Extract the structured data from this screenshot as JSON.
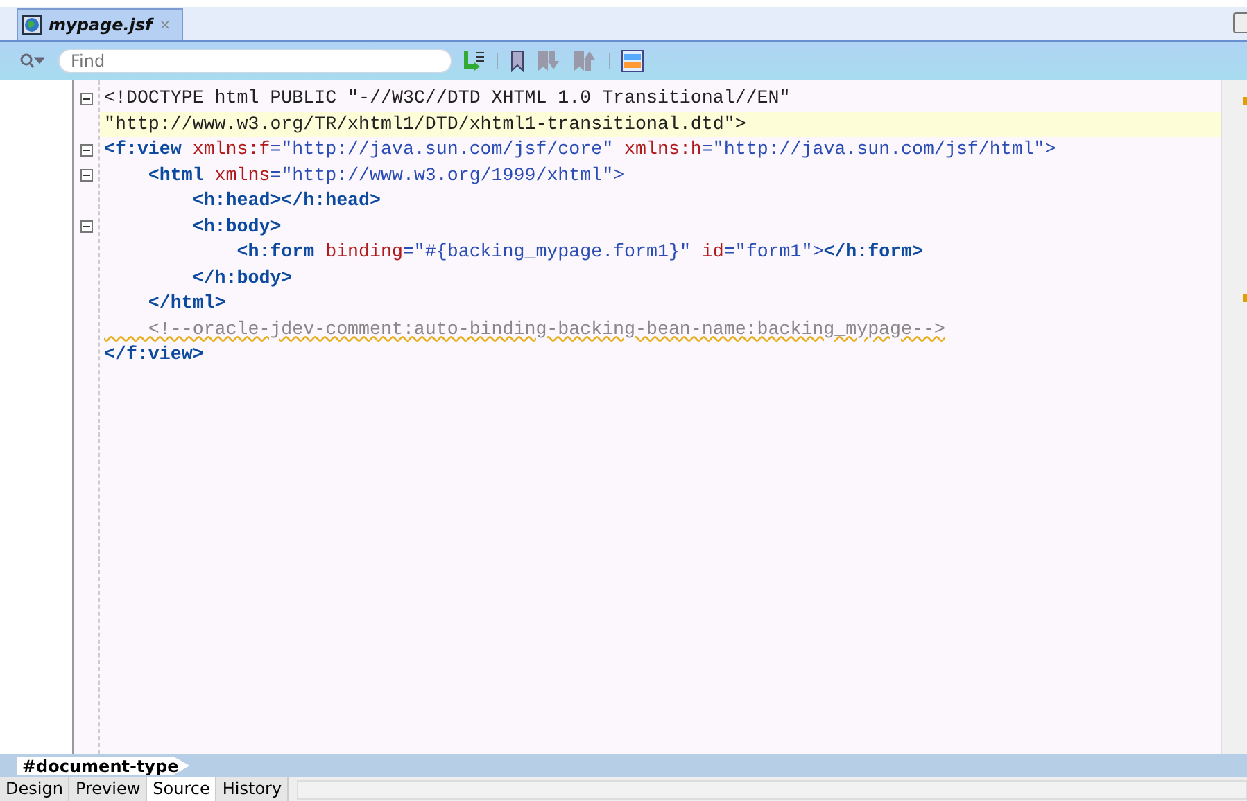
{
  "editor_tab": {
    "title": "mypage.jsf",
    "close": "×",
    "selected": true
  },
  "toolbar": {
    "search": {
      "placeholder": "Find"
    }
  },
  "code_lines": [
    {
      "fold": true,
      "current": false,
      "tokens": [
        {
          "kind": "text",
          "text": "<!DOCTYPE html PUBLIC \"-//W3C//DTD XHTML 1.0 Transitional//EN\""
        }
      ]
    },
    {
      "fold": false,
      "current": true,
      "tokens": [
        {
          "kind": "text",
          "text": "\"http://www.w3.org/TR/xhtml1/DTD/xhtml1-transitional.dtd\">"
        }
      ]
    },
    {
      "fold": true,
      "current": false,
      "tokens": [
        {
          "kind": "tag",
          "text": "<f:view"
        },
        {
          "kind": "attr",
          "text": " xmlns:f"
        },
        {
          "kind": "value",
          "text": "=\"http://java.sun.com/jsf/core\""
        },
        {
          "kind": "attr",
          "text": " xmlns:h"
        },
        {
          "kind": "value",
          "text": "=\"http://java.sun.com/jsf/html\">"
        }
      ]
    },
    {
      "fold": true,
      "current": false,
      "tokens": [
        {
          "kind": "tag",
          "text": "    <html"
        },
        {
          "kind": "attr",
          "text": " xmlns"
        },
        {
          "kind": "value",
          "text": "=\"http://www.w3.org/1999/xhtml\">"
        }
      ]
    },
    {
      "fold": false,
      "current": false,
      "tokens": [
        {
          "kind": "tag",
          "text": "        <h:head></h:head>"
        }
      ]
    },
    {
      "fold": true,
      "current": false,
      "tokens": [
        {
          "kind": "tag",
          "text": "        <h:body>"
        }
      ]
    },
    {
      "fold": false,
      "current": false,
      "tokens": [
        {
          "kind": "tag",
          "text": "            <h:form"
        },
        {
          "kind": "attr",
          "text": " binding"
        },
        {
          "kind": "value",
          "text": "=\"#{backing_mypage.form1}\""
        },
        {
          "kind": "attr",
          "text": " id"
        },
        {
          "kind": "value",
          "text": "=\"form1\">"
        },
        {
          "kind": "tag",
          "text": "</h:form>"
        }
      ]
    },
    {
      "fold": false,
      "current": false,
      "tokens": [
        {
          "kind": "tag",
          "text": "        </h:body>"
        }
      ]
    },
    {
      "fold": false,
      "current": false,
      "tokens": [
        {
          "kind": "tag",
          "text": "    </html>"
        }
      ]
    },
    {
      "fold": false,
      "current": false,
      "tokens": [
        {
          "kind": "comment",
          "text": "    <!--oracle-jdev-comment:auto-binding-backing-bean-name:backing_mypage-->"
        }
      ]
    },
    {
      "fold": false,
      "current": false,
      "tokens": [
        {
          "kind": "tag",
          "text": "</f:view>"
        }
      ]
    }
  ],
  "breadcrumb": "#document-type",
  "view_tabs": [
    {
      "label": "Design",
      "selected": false
    },
    {
      "label": "Preview",
      "selected": false
    },
    {
      "label": "Source",
      "selected": true
    },
    {
      "label": "History",
      "selected": false
    }
  ]
}
